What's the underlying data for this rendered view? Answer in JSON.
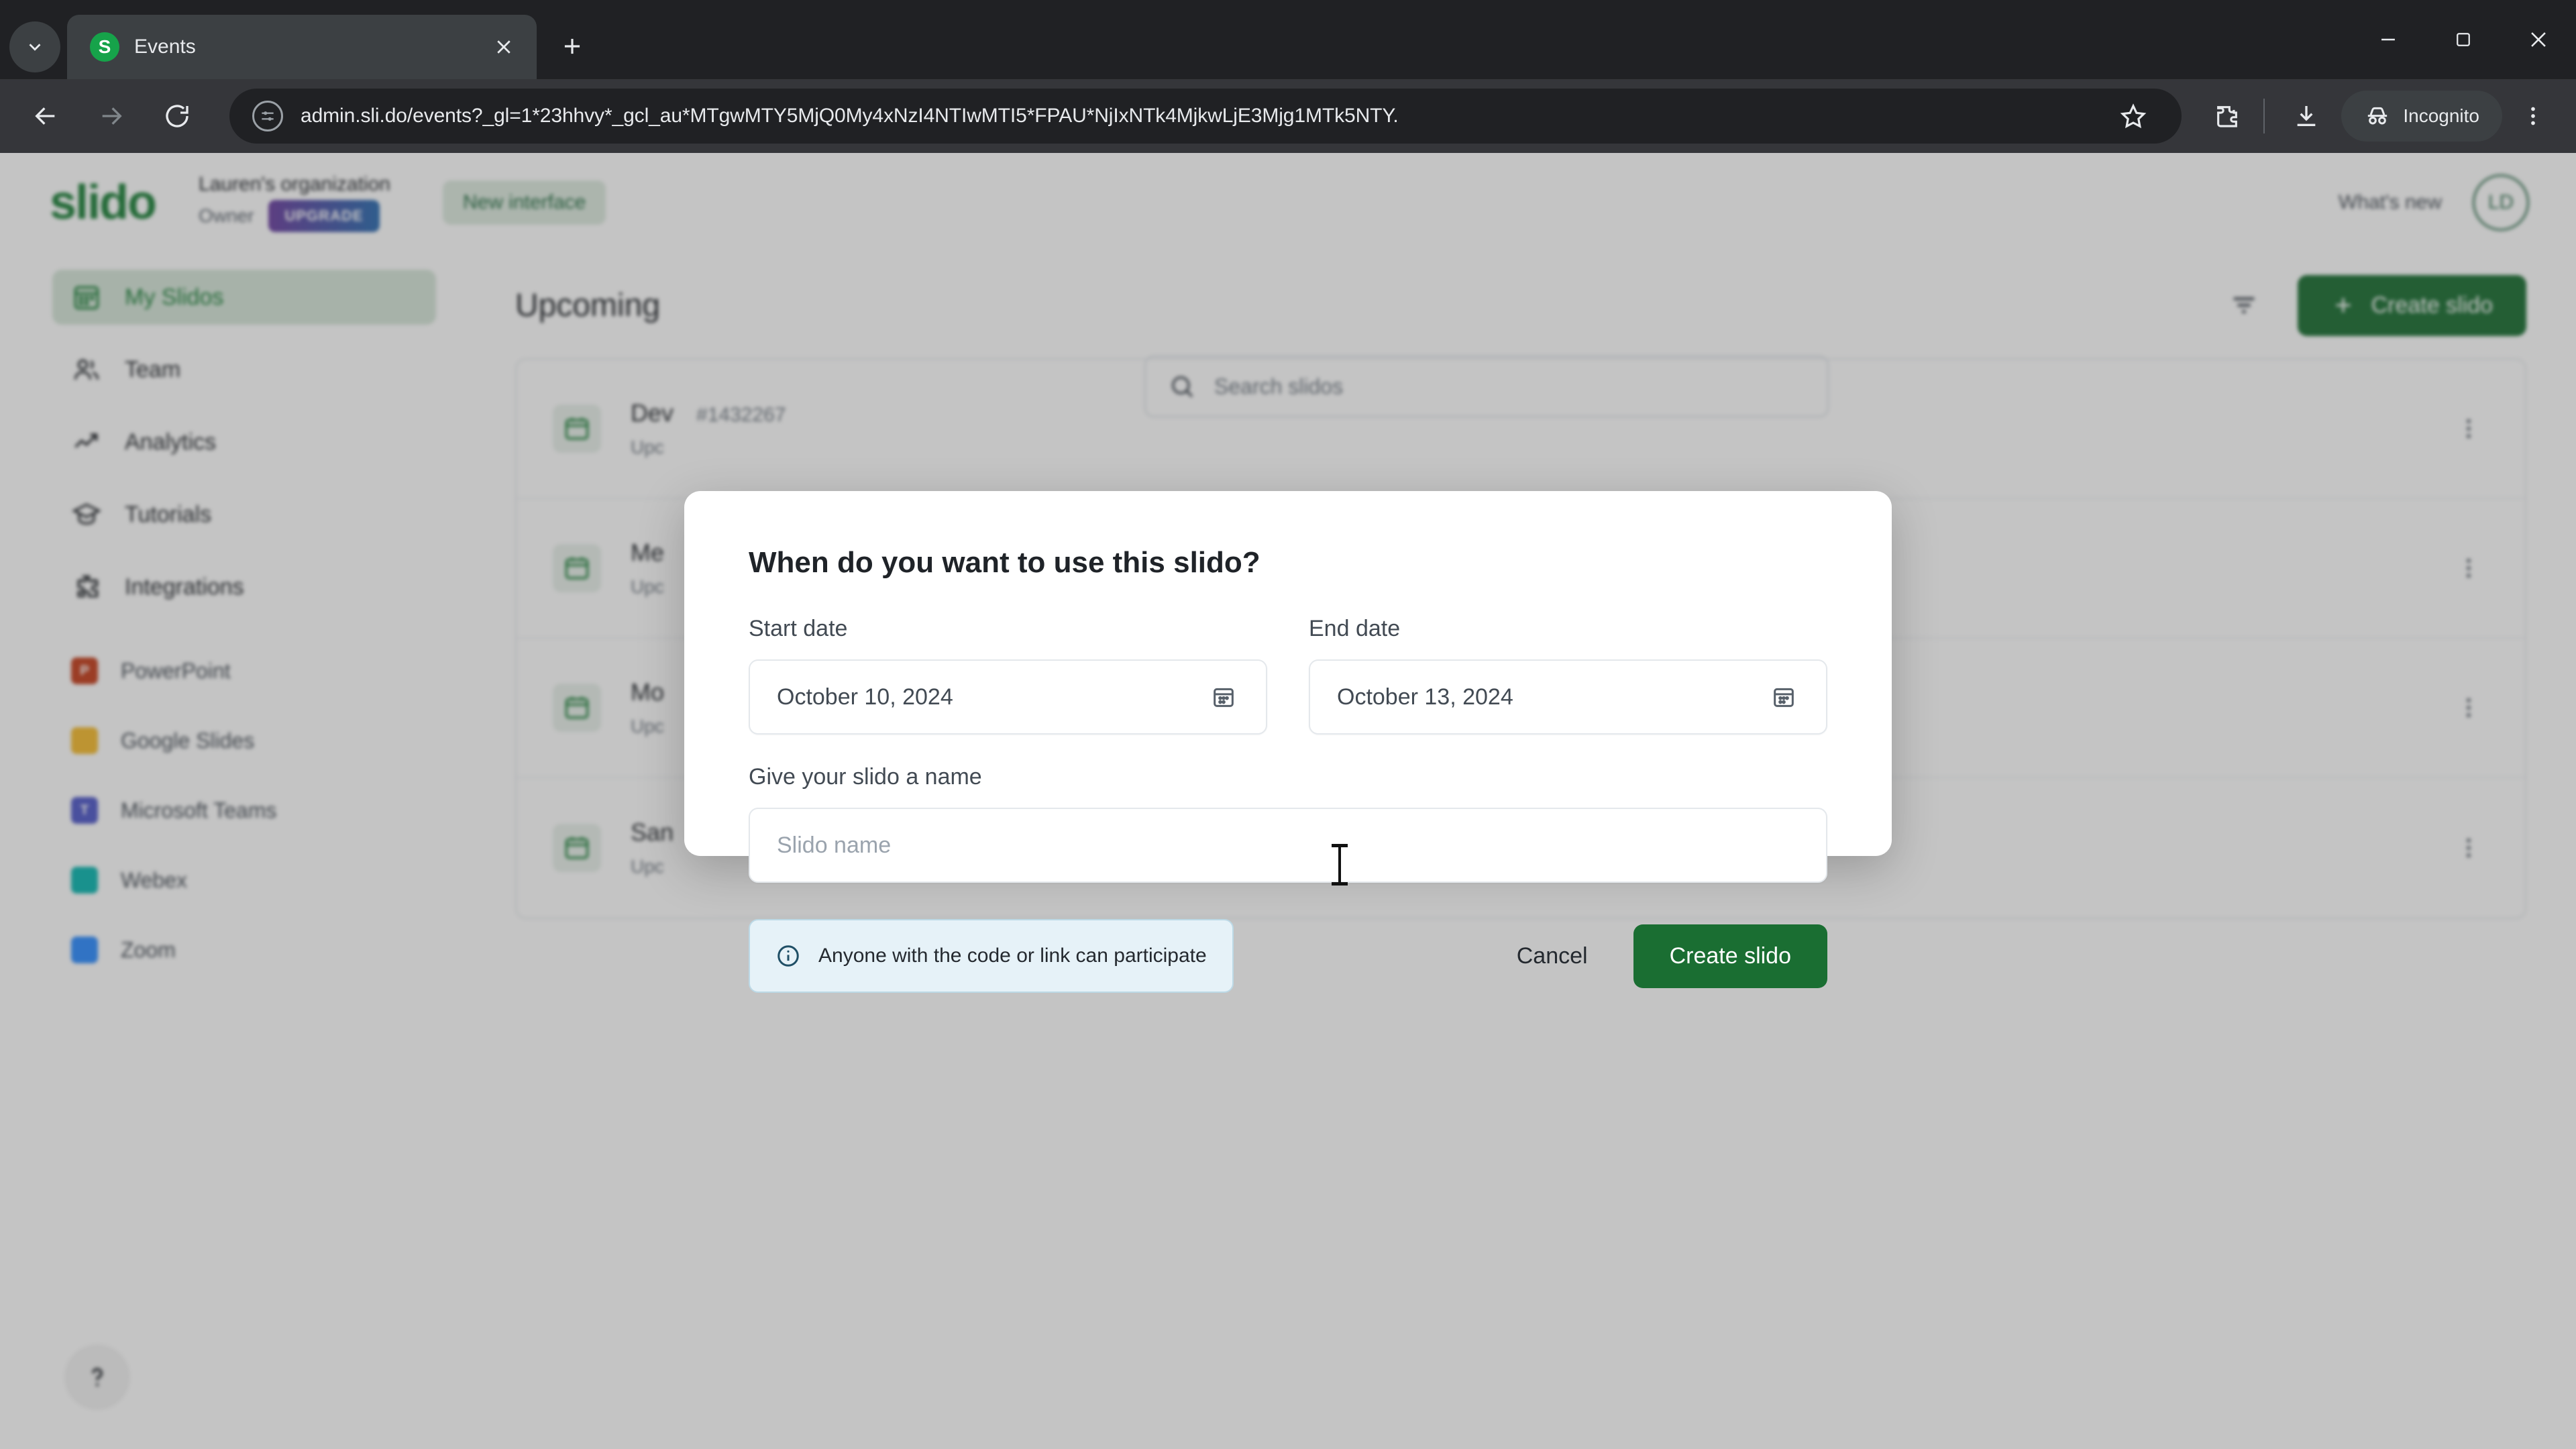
{
  "browser": {
    "tab": {
      "title": "Events",
      "favicon_letter": "S"
    },
    "url": "admin.sli.do/events?_gl=1*23hhvy*_gcl_au*MTgwMTY5MjQ0My4xNzI4NTIwMTI5*FPAU*NjIxNTk4MjkwLjE3Mjg1MTk5NTY.",
    "profile_label": "Incognito",
    "icons": {
      "tab_search": "chevron-down-icon",
      "new_tab": "plus-icon",
      "close_tab": "close-icon",
      "minimize": "minimize-icon",
      "maximize": "maximize-icon",
      "close_window": "close-icon",
      "back": "arrow-left-icon",
      "forward": "arrow-right-icon",
      "reload": "reload-icon",
      "site_info": "site-settings-icon",
      "bookmark": "star-icon",
      "extensions": "extensions-icon",
      "downloads": "download-icon",
      "menu": "three-dots-vertical-icon"
    }
  },
  "app": {
    "logo_text": "slido",
    "org_name": "Lauren's organization",
    "org_role": "Owner",
    "upgrade_label": "UPGRADE",
    "new_interface_label": "New interface",
    "whats_new_label": "What's new",
    "avatar_initials": "LD"
  },
  "search": {
    "placeholder": "Search slidos"
  },
  "sidebar": {
    "nav": [
      {
        "label": "My Slidos",
        "icon": "calendar-grid-icon",
        "active": true
      },
      {
        "label": "Team",
        "icon": "people-icon",
        "active": false
      },
      {
        "label": "Analytics",
        "icon": "trending-up-icon",
        "active": false
      },
      {
        "label": "Tutorials",
        "icon": "graduation-cap-icon",
        "active": false
      },
      {
        "label": "Integrations",
        "icon": "puzzle-piece-icon",
        "active": false
      }
    ],
    "apps": [
      {
        "label": "PowerPoint",
        "icon": "powerpoint-icon",
        "color": "#c43e1c",
        "glyph": "P"
      },
      {
        "label": "Google Slides",
        "icon": "google-slides-icon",
        "color": "#f5bb2e",
        "glyph": ""
      },
      {
        "label": "Microsoft Teams",
        "icon": "microsoft-teams-icon",
        "color": "#5059c9",
        "glyph": "T"
      },
      {
        "label": "Webex",
        "icon": "webex-icon",
        "color": "#0bb6b0",
        "glyph": ""
      },
      {
        "label": "Zoom",
        "icon": "zoom-icon",
        "color": "#2d8cff",
        "glyph": ""
      }
    ],
    "help_icon": "question-mark-icon"
  },
  "main": {
    "section_title": "Upcoming",
    "filter_icon": "filter-icon",
    "create_button": "Create slido",
    "rows": [
      {
        "title": "Dev",
        "code": "#1432267",
        "subtitle": "Upc"
      },
      {
        "title": "Me",
        "code": "",
        "subtitle": "Upc"
      },
      {
        "title": "Mo",
        "code": "",
        "subtitle": "Upc"
      },
      {
        "title": "San",
        "code": "",
        "subtitle": "Upc"
      }
    ]
  },
  "modal": {
    "title": "When do you want to use this slido?",
    "start_label": "Start date",
    "start_value": "October 10, 2024",
    "end_label": "End date",
    "end_value": "October 13, 2024",
    "name_label": "Give your slido a name",
    "name_placeholder": "Slido name",
    "name_value": "",
    "notice": "Anyone with the code or link can participate",
    "notice_icon": "info-icon",
    "calendar_icon": "calendar-icon",
    "cancel_label": "Cancel",
    "create_label": "Create slido"
  },
  "colors": {
    "brand_green": "#1a7f37",
    "button_green": "#1a6e32",
    "notice_bg": "#e6f2f8",
    "chrome_dark": "#202124",
    "chrome_toolbar": "#35363a"
  }
}
